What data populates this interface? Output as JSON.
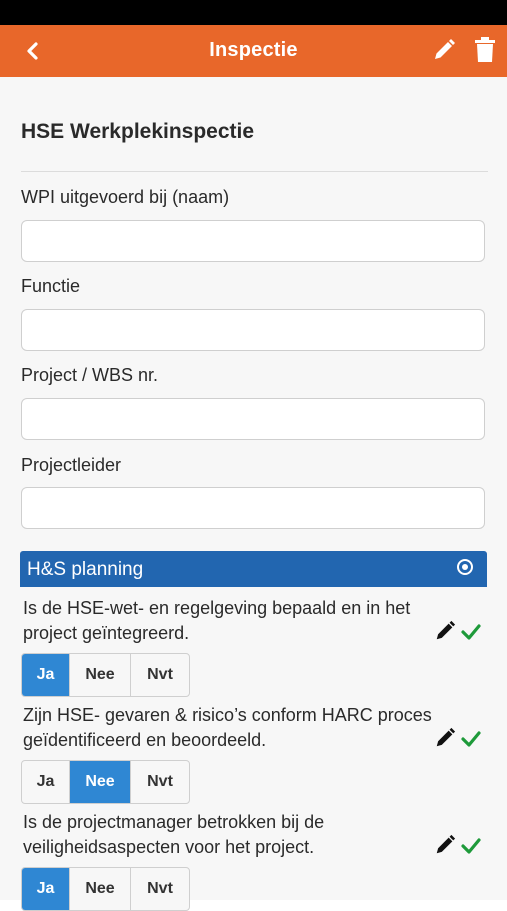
{
  "nav": {
    "title": "Inspectie",
    "accent_color": "#e8672a",
    "back_icon": "chevron-left-icon",
    "edit_icon": "pencil-icon",
    "delete_icon": "trash-icon"
  },
  "form": {
    "title": "HSE Werkplekinspectie",
    "fields": [
      {
        "label": "WPI uitgevoerd bij (naam)",
        "value": ""
      },
      {
        "label": "Functie",
        "value": ""
      },
      {
        "label": "Project / WBS nr.",
        "value": ""
      },
      {
        "label": "Projectleider",
        "value": ""
      }
    ]
  },
  "section": {
    "title": "H&S planning",
    "color": "#2266b0",
    "questions": [
      {
        "text": "Is de HSE-wet- en regelgeving bepaald en in het project geïntegreerd.",
        "options": [
          "Ja",
          "Nee",
          "Nvt"
        ],
        "selected": "Ja"
      },
      {
        "text": "Zijn HSE- gevaren & risico’s conform HARC proces geïdentificeerd en beoordeeld.",
        "options": [
          "Ja",
          "Nee",
          "Nvt"
        ],
        "selected": "Nee"
      },
      {
        "text": "Is de projectmanager betrokken bij de veiligheidsaspecten voor het project.",
        "options": [
          "Ja",
          "Nee",
          "Nvt"
        ],
        "selected": "Ja"
      }
    ]
  },
  "colors": {
    "selected_option": "#2f87d3",
    "check": "#1e9a3a"
  }
}
